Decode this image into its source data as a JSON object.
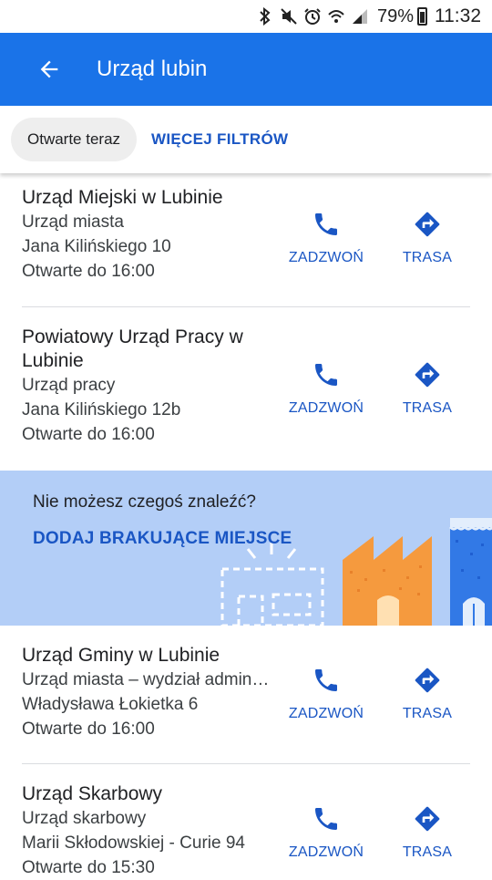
{
  "status_bar": {
    "battery": "79%",
    "time": "11:32"
  },
  "app_bar": {
    "title": "Urząd lubin"
  },
  "filters": {
    "chip": "Otwarte teraz",
    "more": "WIĘCEJ FILTRÓW"
  },
  "actions": {
    "call": "ZADZWOŃ",
    "route": "TRASA"
  },
  "results": [
    {
      "name": "Urząd Miejski w Lubinie",
      "category": "Urząd miasta",
      "address": "Jana Kilińskiego 10",
      "hours": "Otwarte do 16:00"
    },
    {
      "name": "Powiatowy Urząd Pracy w Lubinie",
      "category": "Urząd pracy",
      "address": "Jana Kilińskiego 12b",
      "hours": "Otwarte do 16:00"
    },
    {
      "name": "Urząd Gminy w Lubinie",
      "category": "Urząd miasta – wydział admin…",
      "address": "Władysława Łokietka 6",
      "hours": "Otwarte do 16:00"
    },
    {
      "name": "Urząd Skarbowy",
      "category": "Urząd skarbowy",
      "address": "Marii Skłodowskiej - Curie 94",
      "hours": "Otwarte do 15:30"
    }
  ],
  "banner": {
    "question": "Nie możesz czegoś znaleźć?",
    "link": "DODAJ BRAKUJĄCE MIEJSCE"
  },
  "colors": {
    "primary": "#1a73e8",
    "link": "#1a56c4",
    "banner": "#b3cef7"
  }
}
